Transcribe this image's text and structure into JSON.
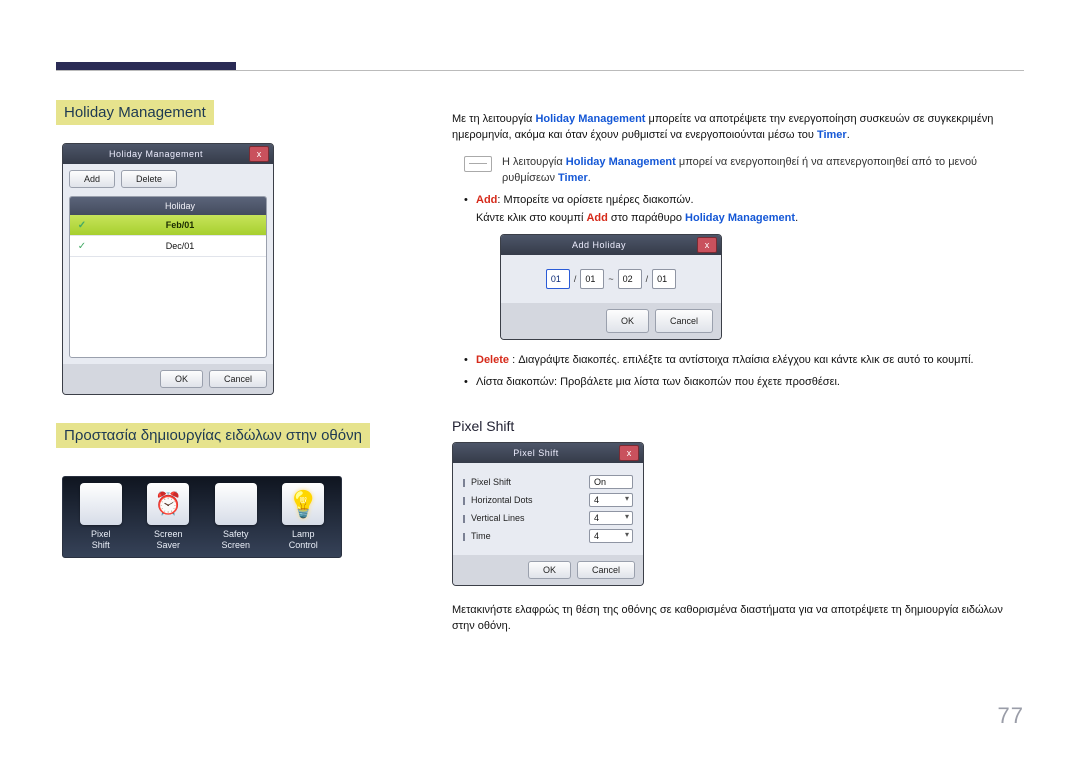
{
  "page_number": "77",
  "sections": {
    "holiday_mgmt_title": "Holiday Management",
    "screen_protection_title": "Προστασία δημιουργίας ειδώλων στην οθόνη"
  },
  "holiday_dialog": {
    "title": "Holiday Management",
    "add_btn": "Add",
    "delete_btn": "Delete",
    "col_header": "Holiday",
    "rows": [
      {
        "value": "Feb/01",
        "selected": true,
        "check": "✓"
      },
      {
        "value": "Dec/01",
        "selected": false,
        "check": "✓"
      }
    ],
    "ok": "OK",
    "cancel": "Cancel"
  },
  "protection_icons": {
    "pixel_shift": "Pixel\nShift",
    "screen_saver": "Screen\nSaver",
    "safety_screen": "Safety\nScreen",
    "lamp_control": "Lamp\nControl"
  },
  "desc": {
    "intro_pre": "Με τη λειτουργία ",
    "intro_kw1": "Holiday Management",
    "intro_mid": " μπορείτε να αποτρέψετε την ενεργοποίηση συσκευών σε συγκεκριμένη ημερομηνία, ακόμα και όταν έχουν ρυθμιστεί να ενεργοποιούνται μέσω του ",
    "intro_kw2": "Timer",
    "intro_end": ".",
    "note_pre": "Η λειτουργία ",
    "note_kw1": "Holiday Management",
    "note_mid": " μπορεί να ενεργοποιηθεί ή να απενεργοποιηθεί από το μενού ρυθμίσεων ",
    "note_kw2": "Timer",
    "note_end": ".",
    "bullet1_kw": "Add",
    "bullet1_rest": ": Μπορείτε να ορίσετε ημέρες διακοπών.",
    "bullet1_sub_pre": "Κάντε κλικ στο κουμπί ",
    "bullet1_sub_kw1": "Add",
    "bullet1_sub_mid": " στο παράθυρο ",
    "bullet1_sub_kw2": "Holiday Management",
    "bullet1_sub_end": ".",
    "bullet2_kw": "Delete",
    "bullet2_rest": " : Διαγράψτε διακοπές. επιλέξτε τα αντίστοιχα πλαίσια ελέγχου και κάντε κλικ σε αυτό το κουμπί.",
    "bullet3": "Λίστα διακοπών: Προβάλετε μια λίστα των διακοπών που έχετε προσθέσει."
  },
  "add_holiday_dialog": {
    "title": "Add Holiday",
    "from_m": "01",
    "from_d": "01",
    "sep": "/",
    "tilde": "~",
    "to_m": "02",
    "to_d": "01",
    "ok": "OK",
    "cancel": "Cancel"
  },
  "pixel_shift": {
    "heading": "Pixel Shift",
    "dialog_title": "Pixel Shift",
    "row1_label": "Pixel Shift",
    "row1_value": "On",
    "row2_label": "Horizontal Dots",
    "row2_value": "4",
    "row3_label": "Vertical Lines",
    "row3_value": "4",
    "row4_label": "Time",
    "row4_value": "4",
    "ok": "OK",
    "cancel": "Cancel",
    "description": "Μετακινήστε ελαφρώς τη θέση της οθόνης σε καθορισμένα διαστήματα για να αποτρέψετε τη δημιουργία ειδώλων στην οθόνη."
  }
}
